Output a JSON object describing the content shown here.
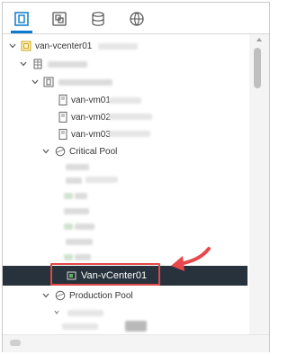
{
  "tabs": [
    {
      "icon": "hosts-clusters-icon",
      "active": true
    },
    {
      "icon": "vms-templates-icon",
      "active": false
    },
    {
      "icon": "storage-icon",
      "active": false
    },
    {
      "icon": "networking-icon",
      "active": false
    }
  ],
  "tree": {
    "vcenter": "van-vcenter01",
    "vms": [
      "van-vm01",
      "van-vm02",
      "van-vm03"
    ],
    "critical_pool": "Critical Pool",
    "selected_vm": "Van-vCenter01",
    "production_pool": "Production Pool"
  },
  "colors": {
    "accent": "#0b7ad1",
    "selected_bg": "#27323c",
    "highlight_box": "#e0484a",
    "arrow": "#e8474c"
  }
}
